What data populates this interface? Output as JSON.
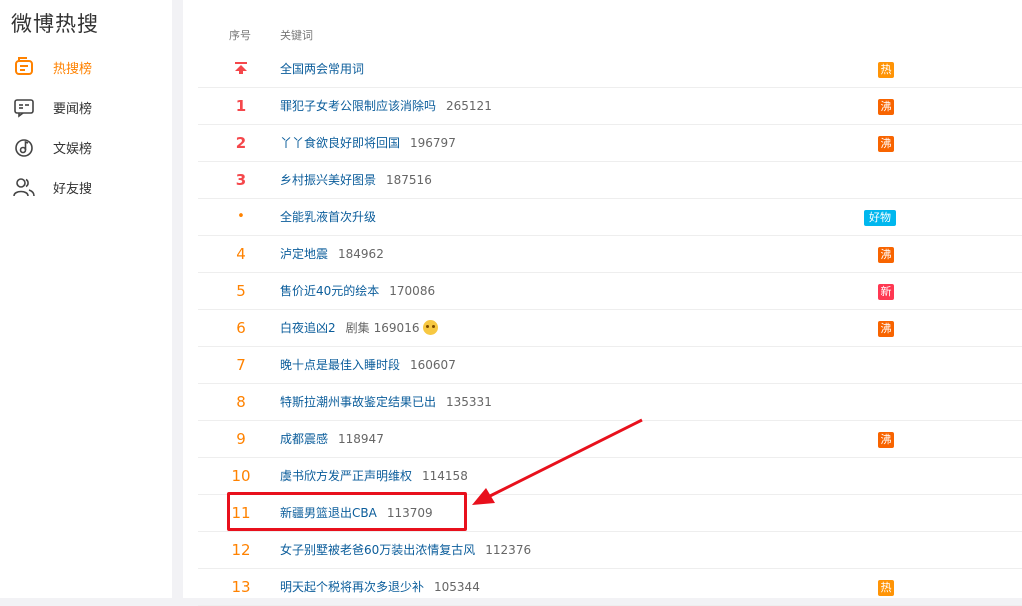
{
  "app": {
    "title": "微博热搜"
  },
  "sidebar": {
    "items": [
      {
        "label": "热搜榜",
        "icon": "hot-list-icon",
        "active": true
      },
      {
        "label": "要闻榜",
        "icon": "news-icon",
        "active": false
      },
      {
        "label": "文娱榜",
        "icon": "music-note-icon",
        "active": false
      },
      {
        "label": "好友搜",
        "icon": "friends-icon",
        "active": false
      }
    ]
  },
  "table": {
    "headers": {
      "rank": "序号",
      "keyword": "关键词"
    },
    "rows": [
      {
        "rank": "",
        "rank_icon": "pin-top-icon",
        "keyword": "全国两会常用词",
        "extra": "",
        "count": "",
        "badge": "热",
        "badge_type": "hot"
      },
      {
        "rank": "1",
        "keyword": "罪犯子女考公限制应该消除吗",
        "extra": "",
        "count": "265121",
        "badge": "沸",
        "badge_type": "boil"
      },
      {
        "rank": "2",
        "keyword": "丫丫食欲良好即将回国",
        "extra": "",
        "count": "196797",
        "badge": "沸",
        "badge_type": "boil"
      },
      {
        "rank": "3",
        "keyword": "乡村振兴美好图景",
        "extra": "",
        "count": "187516",
        "badge": "",
        "badge_type": ""
      },
      {
        "rank": "•",
        "keyword": "全能乳液首次升级",
        "extra": "",
        "count": "",
        "badge": "好物",
        "badge_type": "good"
      },
      {
        "rank": "4",
        "keyword": "泸定地震",
        "extra": "",
        "count": "184962",
        "badge": "沸",
        "badge_type": "boil"
      },
      {
        "rank": "5",
        "keyword": "售价近40元的绘本",
        "extra": "",
        "count": "170086",
        "badge": "新",
        "badge_type": "new"
      },
      {
        "rank": "6",
        "keyword": "白夜追凶2",
        "extra": "剧集",
        "count": "169016",
        "emoji": "crying-face-icon",
        "badge": "沸",
        "badge_type": "boil"
      },
      {
        "rank": "7",
        "keyword": "晚十点是最佳入睡时段",
        "extra": "",
        "count": "160607",
        "badge": "",
        "badge_type": ""
      },
      {
        "rank": "8",
        "keyword": "特斯拉潮州事故鉴定结果已出",
        "extra": "",
        "count": "135331",
        "badge": "",
        "badge_type": ""
      },
      {
        "rank": "9",
        "keyword": "成都震感",
        "extra": "",
        "count": "118947",
        "badge": "沸",
        "badge_type": "boil"
      },
      {
        "rank": "10",
        "keyword": "虞书欣方发严正声明维权",
        "extra": "",
        "count": "114158",
        "badge": "",
        "badge_type": ""
      },
      {
        "rank": "11",
        "keyword": "新疆男篮退出CBA",
        "extra": "",
        "count": "113709",
        "badge": "",
        "badge_type": ""
      },
      {
        "rank": "12",
        "keyword": "女子别墅被老爸60万装出浓情复古风",
        "extra": "",
        "count": "112376",
        "badge": "",
        "badge_type": ""
      },
      {
        "rank": "13",
        "keyword": "明天起个税将再次多退少补",
        "extra": "",
        "count": "105344",
        "badge": "热",
        "badge_type": "hot"
      }
    ]
  },
  "colors": {
    "accent": "#ff8200",
    "rank_top": "#f5474b",
    "link": "#0b5d9b",
    "annotation": "#e8101c"
  }
}
